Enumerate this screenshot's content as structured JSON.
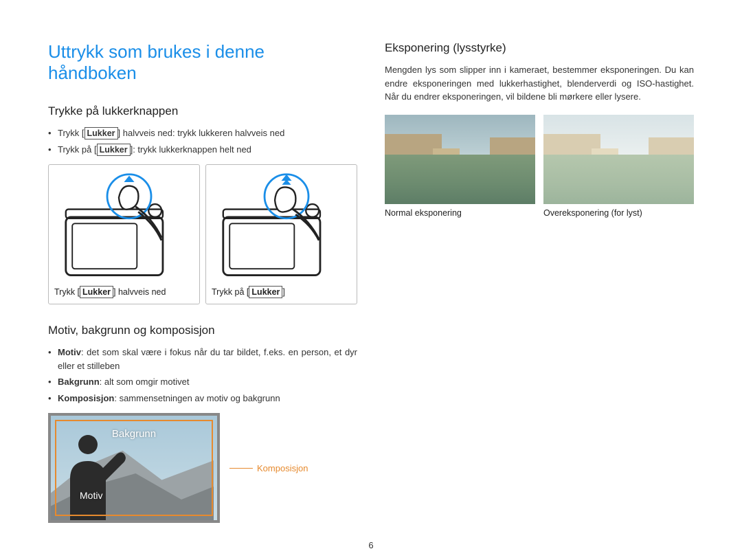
{
  "title": "Uttrykk som brukes i denne håndboken",
  "pageNumber": "6",
  "left": {
    "section1": {
      "heading": "Trykke på lukkerknappen",
      "bullets": [
        {
          "pre": "Trykk [",
          "key": "Lukker",
          "post": "] halvveis ned: trykk lukkeren halvveis ned"
        },
        {
          "pre": "Trykk på [",
          "key": "Lukker",
          "post": "]: trykk lukkerknappen helt ned"
        }
      ],
      "fig1Caption": {
        "pre": "Trykk [",
        "key": "Lukker",
        "post": "] halvveis ned"
      },
      "fig2Caption": {
        "pre": "Trykk på [",
        "key": "Lukker",
        "post": "]"
      }
    },
    "section2": {
      "heading": "Motiv, bakgrunn og komposisjon",
      "bullets": [
        {
          "term": "Motiv",
          "text": ": det som skal være i fokus når du tar bildet, f.eks. en person, et dyr eller et stilleben"
        },
        {
          "term": "Bakgrunn",
          "text": ": alt som omgir motivet"
        },
        {
          "term": "Komposisjon",
          "text": ": sammensetningen av motiv og bakgrunn"
        }
      ],
      "labels": {
        "bakgrunn": "Bakgrunn",
        "motiv": "Motiv",
        "komposisjon": "Komposisjon"
      }
    }
  },
  "right": {
    "heading": "Eksponering (lysstyrke)",
    "paragraph": "Mengden lys som slipper inn i kameraet, bestemmer eksponeringen. Du kan endre eksponeringen med lukkerhastighet, blenderverdi og ISO-hastighet. Når du endrer eksponeringen, vil bildene bli mørkere eller lysere.",
    "photo1Caption": "Normal eksponering",
    "photo2Caption": "Overeksponering (for lyst)"
  }
}
